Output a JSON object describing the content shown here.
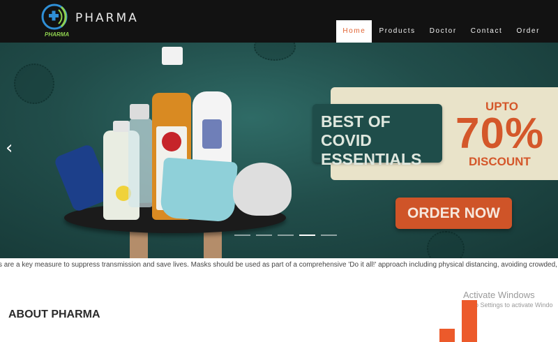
{
  "brand": {
    "name": "PHARMA",
    "sublabel": "PHARMA"
  },
  "nav": {
    "items": [
      {
        "label": "Home",
        "active": true
      },
      {
        "label": "Products",
        "active": false
      },
      {
        "label": "Doctor",
        "active": false
      },
      {
        "label": "Contact",
        "active": false
      },
      {
        "label": "Order",
        "active": false
      }
    ]
  },
  "hero": {
    "promo_heading": "BEST OF COVID ESSENTIALS",
    "discount_prefix": "UPTO",
    "discount_value": "70%",
    "discount_suffix": "DISCOUNT",
    "cta_label": "ORDER NOW",
    "slide_count": 5,
    "active_slide": 4
  },
  "ticker": {
    "text": "ks are a key measure to suppress transmission and save lives. Masks should be used as part of a comprehensive 'Do it all!' approach including physical distancing, avoiding crowded, closed and clos"
  },
  "watermark": {
    "title": "Activate Windows",
    "subtitle": "Go to Settings to activate Windo"
  },
  "about": {
    "heading": "ABOUT PHARMA"
  },
  "colors": {
    "nav_bg": "#121212",
    "accent": "#d4572a",
    "hero_bg": "#214d4a",
    "promo_card": "#e9e3c9"
  }
}
